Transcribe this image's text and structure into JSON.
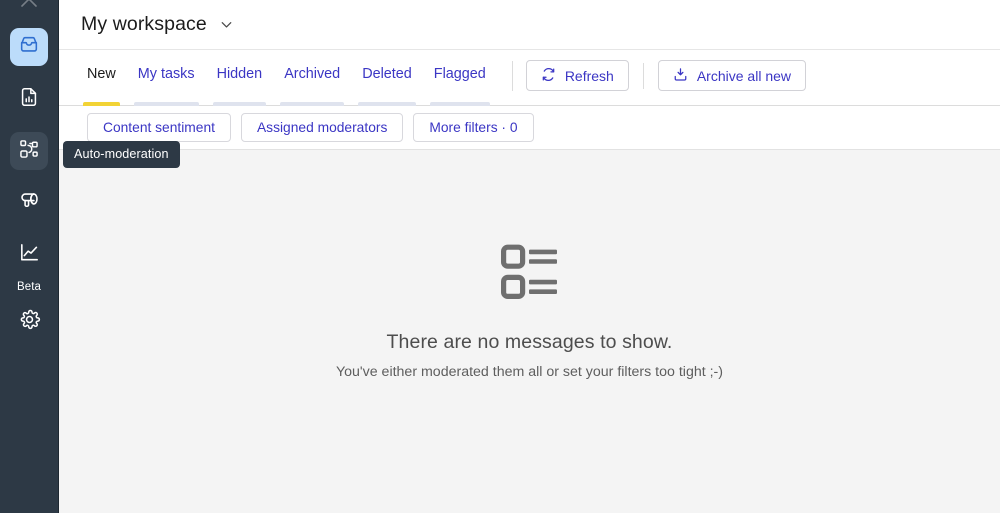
{
  "sidebar": {
    "items": [
      {
        "label": "Inbox",
        "icon": "inbox-icon",
        "state": "active"
      },
      {
        "label": "Reports",
        "icon": "report-document-icon",
        "state": "default"
      },
      {
        "label": "Auto-moderation",
        "icon": "auto-moderation-nodes-icon",
        "state": "hover"
      },
      {
        "label": "Announcements",
        "icon": "megaphone-icon",
        "state": "default"
      },
      {
        "label": "Analytics",
        "icon": "line-chart-icon",
        "state": "default"
      },
      {
        "label": "Settings",
        "icon": "gear-icon",
        "state": "default"
      }
    ],
    "beta_label": "Beta",
    "colors": {
      "background": "#2d3945",
      "active_bg": "#bcdcfa",
      "active_fg": "#2f6fd0",
      "hover_bg": "#3d4a57"
    }
  },
  "tooltip": {
    "text": "Auto-moderation"
  },
  "header": {
    "workspace_title": "My workspace",
    "caret_icon": "chevron-down-icon"
  },
  "tabs": [
    {
      "label": "New",
      "active": true
    },
    {
      "label": "My tasks",
      "active": false
    },
    {
      "label": "Hidden",
      "active": false
    },
    {
      "label": "Archived",
      "active": false
    },
    {
      "label": "Deleted",
      "active": false
    },
    {
      "label": "Flagged",
      "active": false
    }
  ],
  "toolbar": {
    "refresh_label": "Refresh",
    "refresh_icon": "refresh-icon",
    "archive_label": "Archive all new",
    "archive_icon": "archive-download-icon"
  },
  "filters": [
    {
      "label": "Content sentiment"
    },
    {
      "label": "Assigned moderators"
    },
    {
      "label": "More filters · 0"
    }
  ],
  "empty_state": {
    "icon": "list-items-icon",
    "title": "There are no messages to show.",
    "subtitle": "You've either moderated them all or set your filters too tight ;-)"
  },
  "colors": {
    "accent_link": "#3b36c4",
    "active_tab_underline": "#f2d335",
    "inactive_tab_underline": "#dfe3ee",
    "content_bg": "#f4f4f4"
  }
}
